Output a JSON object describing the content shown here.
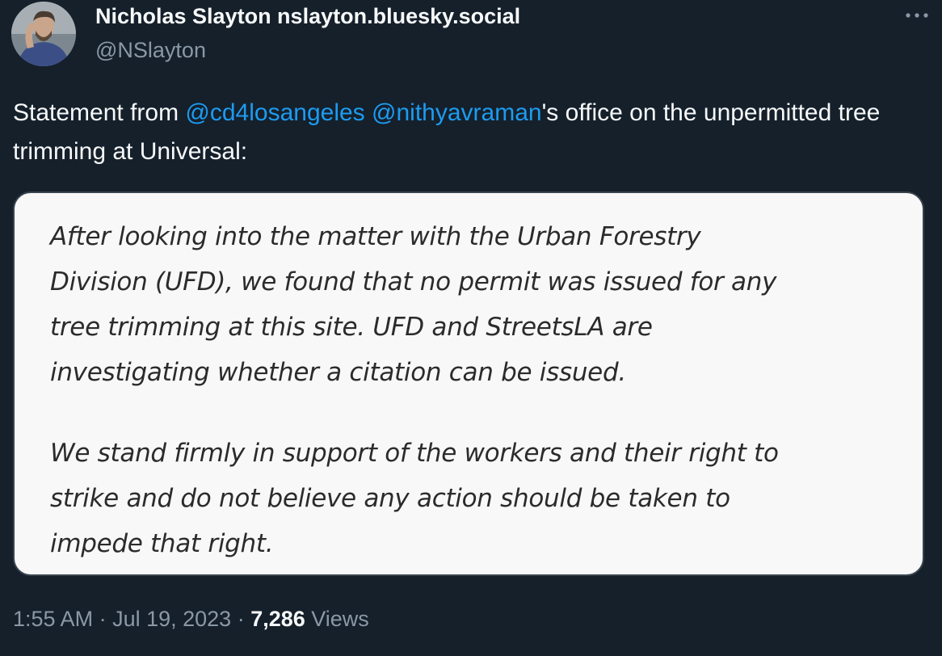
{
  "author": {
    "display_name": "Nicholas Slayton nslayton.bluesky.social",
    "handle": "@NSlayton"
  },
  "more_icon": "more-horizontal-icon",
  "tweet": {
    "text_before": "Statement from ",
    "mention_1": "@cd4losangeles",
    "space": " ",
    "mention_2": "@nithyavraman",
    "text_after": "'s office on the unpermitted tree trimming at Universal:"
  },
  "media": {
    "paragraph_1": "After looking into the matter with the Urban Forestry\nDivision (UFD), we found that no permit was issued for any\ntree trimming at this site. UFD and StreetsLA are\ninvestigating whether a citation can be issued.",
    "paragraph_2": "We stand firmly in support of the workers and their right to\nstrike and do not believe any action should be taken to\nimpede that right."
  },
  "meta": {
    "time": "1:55 AM",
    "separator": " · ",
    "date": "Jul 19, 2023",
    "views_count": "7,286",
    "views_label": " Views"
  },
  "colors": {
    "background": "#15202b",
    "accent": "#1d9bf0",
    "secondary_text": "#8b98a5"
  }
}
